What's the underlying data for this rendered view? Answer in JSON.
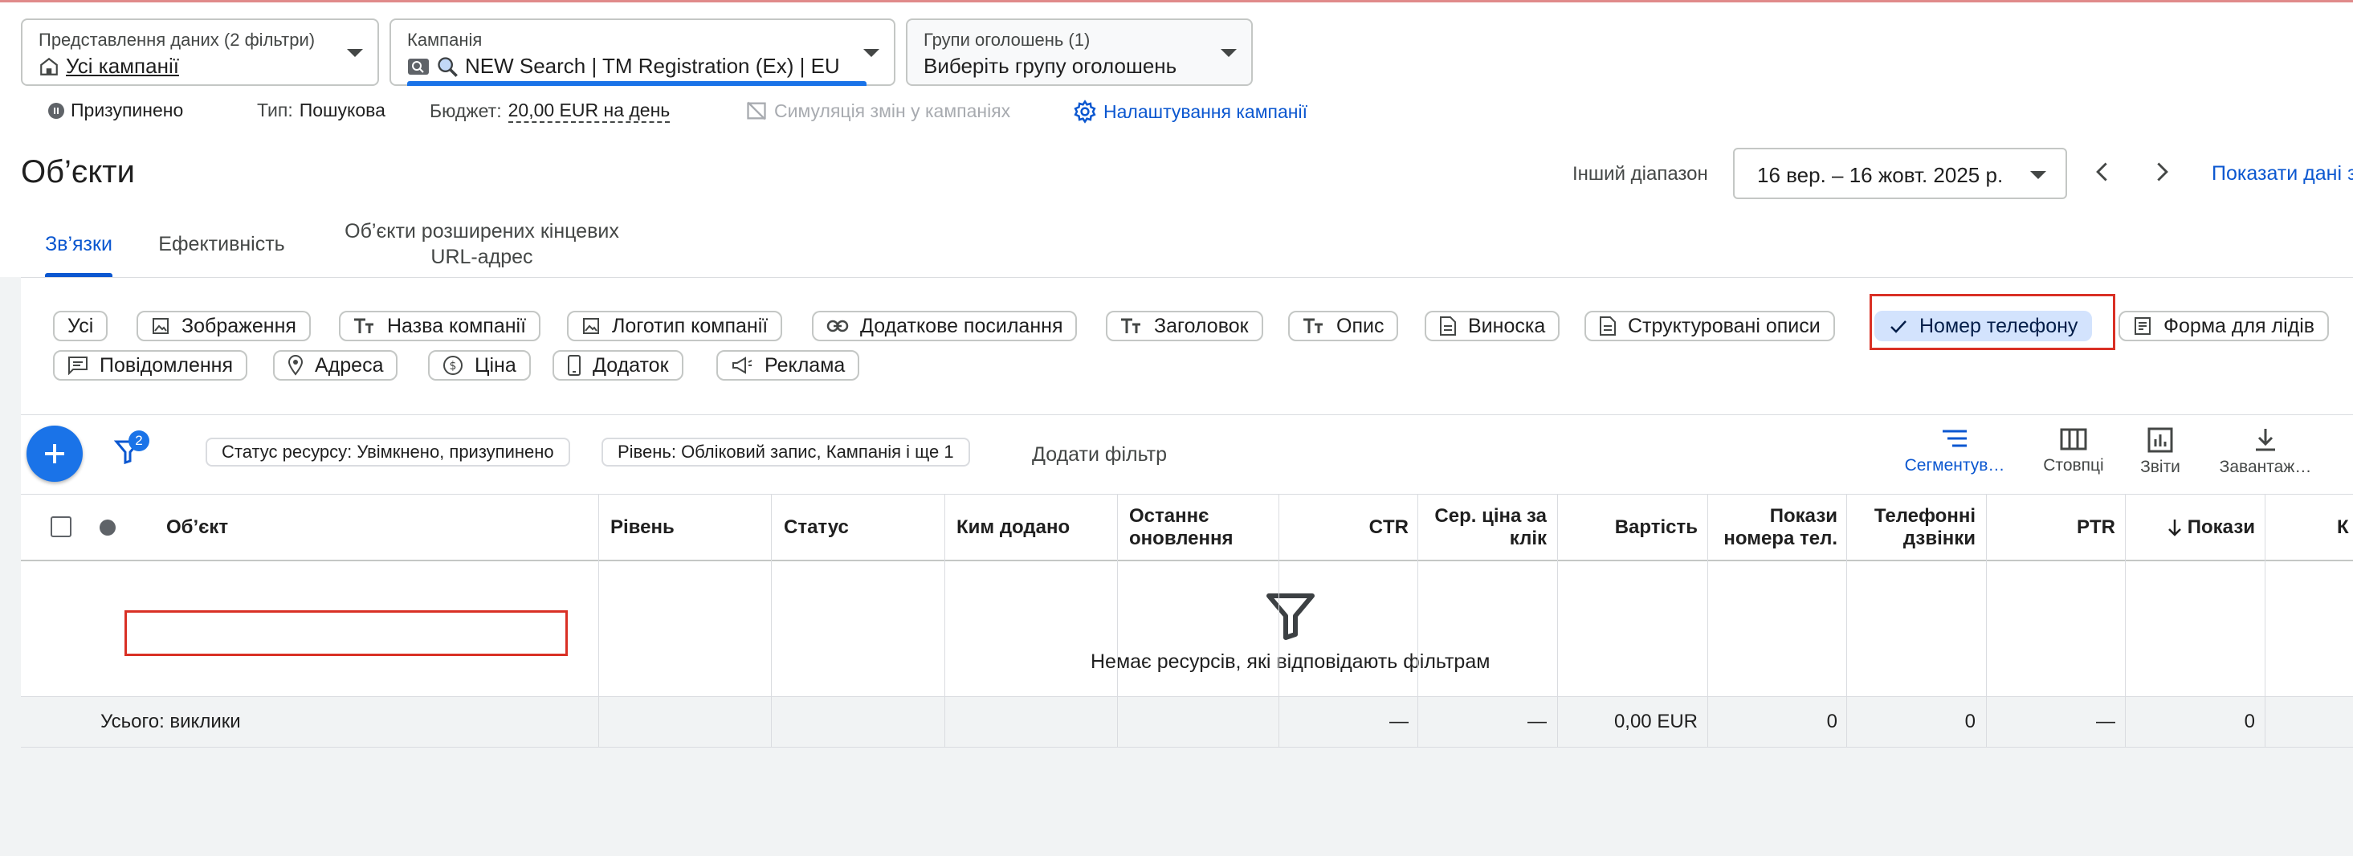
{
  "selectors": {
    "view": {
      "label": "Представлення даних (2 фільтри)",
      "value": "Усі кампанії"
    },
    "campaign": {
      "label": "Кампанія",
      "value": "NEW Search | TM Registration (Ex) | EU"
    },
    "adgroup": {
      "label": "Групи оголошень (1)",
      "value": "Виберіть групу оголошень"
    }
  },
  "status_bar": {
    "status": "Призупинено",
    "type_label": "Тип:",
    "type_value": "Пошукова",
    "budget_label": "Бюджет:",
    "budget_value": "20,00 EUR на день",
    "simulation": "Симуляція змін у кампаніях",
    "settings": "Налаштування кампанії"
  },
  "page": {
    "title": "Об’єкти",
    "range_label": "Інший діапазон",
    "date_range": "16 вер. – 16 жовт. 2025 р.",
    "show_data": "Показати дані з"
  },
  "tabs": [
    {
      "label": "Зв’язки",
      "active": true
    },
    {
      "label": "Ефективність",
      "active": false
    },
    {
      "label": "Об’єкти розширених кінцевих URL-адрес",
      "active": false
    }
  ],
  "chips": [
    {
      "label": "Усі",
      "icon": "none"
    },
    {
      "label": "Зображення",
      "icon": "image-icon"
    },
    {
      "label": "Назва компанії",
      "icon": "text-icon"
    },
    {
      "label": "Логотип компанії",
      "icon": "image-icon"
    },
    {
      "label": "Додаткове посилання",
      "icon": "link-icon"
    },
    {
      "label": "Заголовок",
      "icon": "text-icon"
    },
    {
      "label": "Опис",
      "icon": "text-icon"
    },
    {
      "label": "Виноска",
      "icon": "document-icon"
    },
    {
      "label": "Структуровані описи",
      "icon": "document-icon"
    },
    {
      "label": "Номер телефону",
      "icon": "check-icon",
      "selected": true
    },
    {
      "label": "Форма для лідів",
      "icon": "form-icon"
    },
    {
      "label": "Повідомлення",
      "icon": "message-icon"
    },
    {
      "label": "Адреса",
      "icon": "location-icon"
    },
    {
      "label": "Ціна",
      "icon": "price-icon"
    },
    {
      "label": "Додаток",
      "icon": "phone-icon"
    },
    {
      "label": "Реклама",
      "icon": "megaphone-icon"
    }
  ],
  "filters": {
    "badge_count": "2",
    "chip1": "Статус ресурсу: Увімкнено, призупинено",
    "chip2": "Рівень: Обліковий запис, Кампанія і ще 1",
    "add_filter": "Додати фільтр"
  },
  "toolbar": {
    "segment": "Сегментув…",
    "columns": "Стовпці",
    "reports": "Звіти",
    "download": "Завантаж…"
  },
  "table": {
    "columns": {
      "object": "Об’єкт",
      "level": "Рівень",
      "status": "Статус",
      "added_by": "Ким додано",
      "last_update": "Останнє оновлення",
      "ctr": "CTR",
      "avg_cpc": "Сер. ціна за клік",
      "cost": "Вартість",
      "phone_impr": "Покази номера тел.",
      "phone_calls": "Телефонні дзвінки",
      "ptr": "PTR",
      "impressions": "Покази",
      "truncated": "К"
    },
    "empty_message": "Немає ресурсів, які відповідають фільтрам",
    "total": {
      "label": "Усього: виклики",
      "ctr": "—",
      "avg_cpc": "—",
      "cost": "0,00 EUR",
      "phone_impr": "0",
      "phone_calls": "0",
      "ptr": "—",
      "impressions": "0"
    }
  },
  "colors": {
    "accent": "#0b57d0",
    "fab": "#1a73e8",
    "highlight": "#d93025",
    "chip_selected": "#d3e3fd"
  }
}
